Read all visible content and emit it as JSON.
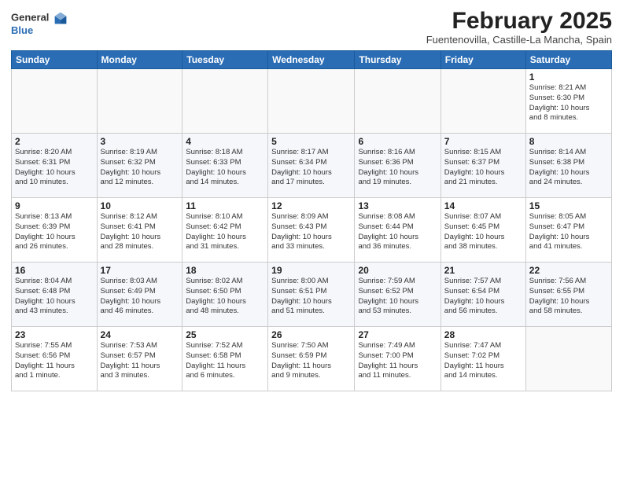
{
  "logo": {
    "line1": "General",
    "line2": "Blue"
  },
  "title": "February 2025",
  "location": "Fuentenovilla, Castille-La Mancha, Spain",
  "weekdays": [
    "Sunday",
    "Monday",
    "Tuesday",
    "Wednesday",
    "Thursday",
    "Friday",
    "Saturday"
  ],
  "weeks": [
    [
      {
        "day": "",
        "info": ""
      },
      {
        "day": "",
        "info": ""
      },
      {
        "day": "",
        "info": ""
      },
      {
        "day": "",
        "info": ""
      },
      {
        "day": "",
        "info": ""
      },
      {
        "day": "",
        "info": ""
      },
      {
        "day": "1",
        "info": "Sunrise: 8:21 AM\nSunset: 6:30 PM\nDaylight: 10 hours\nand 8 minutes."
      }
    ],
    [
      {
        "day": "2",
        "info": "Sunrise: 8:20 AM\nSunset: 6:31 PM\nDaylight: 10 hours\nand 10 minutes."
      },
      {
        "day": "3",
        "info": "Sunrise: 8:19 AM\nSunset: 6:32 PM\nDaylight: 10 hours\nand 12 minutes."
      },
      {
        "day": "4",
        "info": "Sunrise: 8:18 AM\nSunset: 6:33 PM\nDaylight: 10 hours\nand 14 minutes."
      },
      {
        "day": "5",
        "info": "Sunrise: 8:17 AM\nSunset: 6:34 PM\nDaylight: 10 hours\nand 17 minutes."
      },
      {
        "day": "6",
        "info": "Sunrise: 8:16 AM\nSunset: 6:36 PM\nDaylight: 10 hours\nand 19 minutes."
      },
      {
        "day": "7",
        "info": "Sunrise: 8:15 AM\nSunset: 6:37 PM\nDaylight: 10 hours\nand 21 minutes."
      },
      {
        "day": "8",
        "info": "Sunrise: 8:14 AM\nSunset: 6:38 PM\nDaylight: 10 hours\nand 24 minutes."
      }
    ],
    [
      {
        "day": "9",
        "info": "Sunrise: 8:13 AM\nSunset: 6:39 PM\nDaylight: 10 hours\nand 26 minutes."
      },
      {
        "day": "10",
        "info": "Sunrise: 8:12 AM\nSunset: 6:41 PM\nDaylight: 10 hours\nand 28 minutes."
      },
      {
        "day": "11",
        "info": "Sunrise: 8:10 AM\nSunset: 6:42 PM\nDaylight: 10 hours\nand 31 minutes."
      },
      {
        "day": "12",
        "info": "Sunrise: 8:09 AM\nSunset: 6:43 PM\nDaylight: 10 hours\nand 33 minutes."
      },
      {
        "day": "13",
        "info": "Sunrise: 8:08 AM\nSunset: 6:44 PM\nDaylight: 10 hours\nand 36 minutes."
      },
      {
        "day": "14",
        "info": "Sunrise: 8:07 AM\nSunset: 6:45 PM\nDaylight: 10 hours\nand 38 minutes."
      },
      {
        "day": "15",
        "info": "Sunrise: 8:05 AM\nSunset: 6:47 PM\nDaylight: 10 hours\nand 41 minutes."
      }
    ],
    [
      {
        "day": "16",
        "info": "Sunrise: 8:04 AM\nSunset: 6:48 PM\nDaylight: 10 hours\nand 43 minutes."
      },
      {
        "day": "17",
        "info": "Sunrise: 8:03 AM\nSunset: 6:49 PM\nDaylight: 10 hours\nand 46 minutes."
      },
      {
        "day": "18",
        "info": "Sunrise: 8:02 AM\nSunset: 6:50 PM\nDaylight: 10 hours\nand 48 minutes."
      },
      {
        "day": "19",
        "info": "Sunrise: 8:00 AM\nSunset: 6:51 PM\nDaylight: 10 hours\nand 51 minutes."
      },
      {
        "day": "20",
        "info": "Sunrise: 7:59 AM\nSunset: 6:52 PM\nDaylight: 10 hours\nand 53 minutes."
      },
      {
        "day": "21",
        "info": "Sunrise: 7:57 AM\nSunset: 6:54 PM\nDaylight: 10 hours\nand 56 minutes."
      },
      {
        "day": "22",
        "info": "Sunrise: 7:56 AM\nSunset: 6:55 PM\nDaylight: 10 hours\nand 58 minutes."
      }
    ],
    [
      {
        "day": "23",
        "info": "Sunrise: 7:55 AM\nSunset: 6:56 PM\nDaylight: 11 hours\nand 1 minute."
      },
      {
        "day": "24",
        "info": "Sunrise: 7:53 AM\nSunset: 6:57 PM\nDaylight: 11 hours\nand 3 minutes."
      },
      {
        "day": "25",
        "info": "Sunrise: 7:52 AM\nSunset: 6:58 PM\nDaylight: 11 hours\nand 6 minutes."
      },
      {
        "day": "26",
        "info": "Sunrise: 7:50 AM\nSunset: 6:59 PM\nDaylight: 11 hours\nand 9 minutes."
      },
      {
        "day": "27",
        "info": "Sunrise: 7:49 AM\nSunset: 7:00 PM\nDaylight: 11 hours\nand 11 minutes."
      },
      {
        "day": "28",
        "info": "Sunrise: 7:47 AM\nSunset: 7:02 PM\nDaylight: 11 hours\nand 14 minutes."
      },
      {
        "day": "",
        "info": ""
      }
    ]
  ]
}
